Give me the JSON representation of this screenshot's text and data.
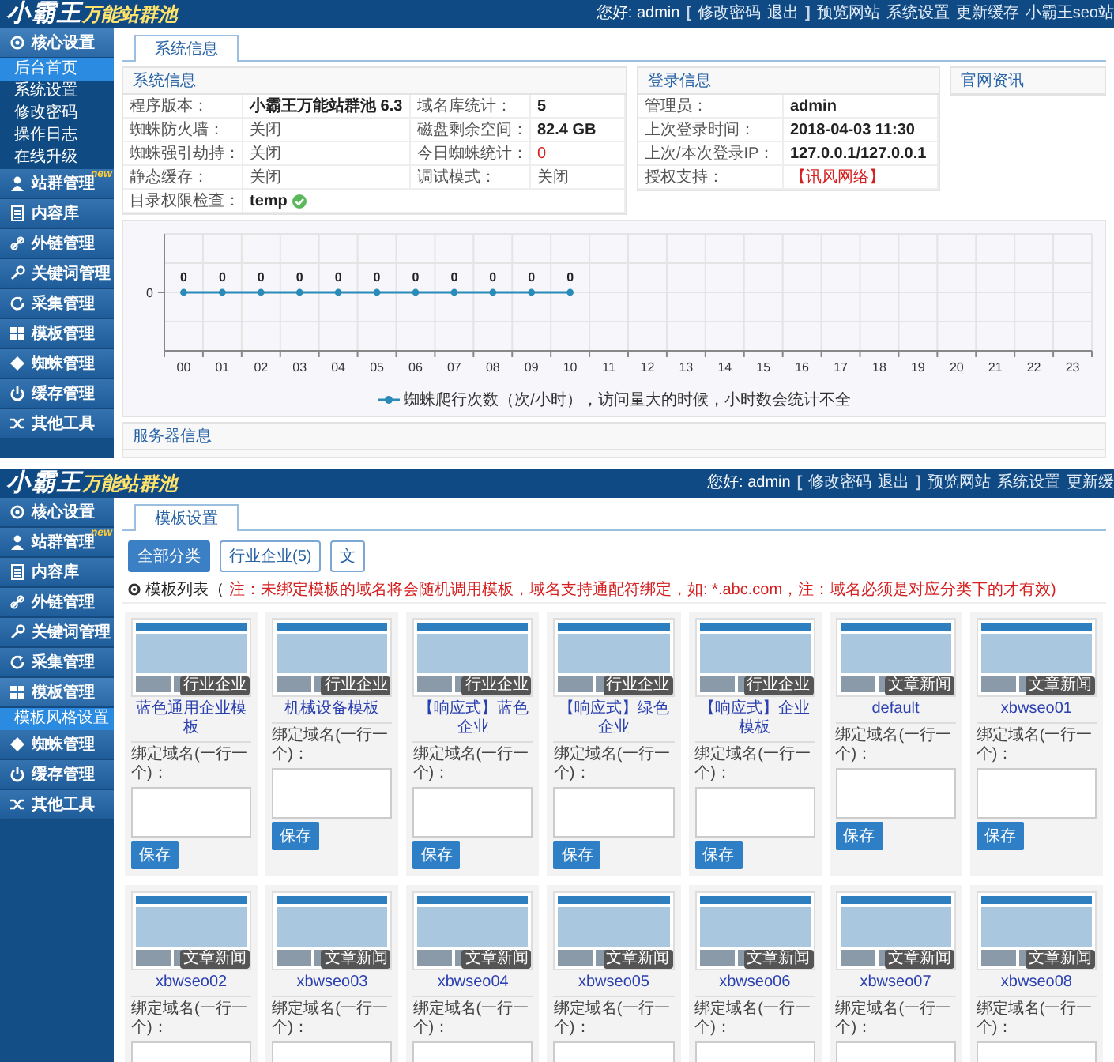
{
  "dashboard_screen": {
    "header": {
      "logo_main": "小霸王",
      "logo_sub": "万能站群池",
      "links": [
        {
          "text": "您好: admin",
          "kind": "greeting"
        },
        {
          "text": "[",
          "kind": "bracket"
        },
        {
          "text": "修改密码",
          "kind": "link"
        },
        {
          "text": "退出",
          "kind": "link"
        },
        {
          "text": "]",
          "kind": "bracket"
        },
        {
          "text": "预览网站",
          "kind": "link"
        },
        {
          "text": "系统设置",
          "kind": "link"
        },
        {
          "text": "更新缓存",
          "kind": "link"
        },
        {
          "text": "小霸王seo站",
          "kind": "link"
        }
      ]
    },
    "sidebar": [
      {
        "label": "核心设置",
        "expanded": true,
        "children": [
          {
            "label": "后台首页",
            "selected": true
          },
          {
            "label": "系统设置",
            "selected": false
          },
          {
            "label": "修改密码",
            "selected": false
          },
          {
            "label": "操作日志",
            "selected": false
          },
          {
            "label": "在线升级",
            "selected": false
          }
        ]
      },
      {
        "label": "站群管理",
        "badge": "new",
        "expanded": false
      },
      {
        "label": "内容库",
        "expanded": false
      },
      {
        "label": "外链管理",
        "expanded": false
      },
      {
        "label": "关键词管理",
        "expanded": false
      },
      {
        "label": "采集管理",
        "expanded": false
      },
      {
        "label": "模板管理",
        "expanded": false
      },
      {
        "label": "蜘蛛管理",
        "expanded": false
      },
      {
        "label": "缓存管理",
        "expanded": false
      },
      {
        "label": "其他工具",
        "expanded": false
      }
    ],
    "tabs": [
      {
        "label": "系统信息",
        "selected": true
      }
    ],
    "system_info": {
      "title": "系统信息",
      "rows": [
        [
          {
            "text": "程序版本：",
            "kind": "label"
          },
          {
            "text": "小霸王万能站群池 6.3",
            "kind": "value"
          },
          {
            "text": "域名库统计：",
            "kind": "label"
          },
          {
            "text": "5",
            "kind": "value"
          }
        ],
        [
          {
            "text": "蜘蛛防火墙：",
            "kind": "label"
          },
          {
            "text": "关闭",
            "kind": "plain"
          },
          {
            "text": "磁盘剩余空间：",
            "kind": "label"
          },
          {
            "text": "82.4 GB",
            "kind": "value"
          }
        ],
        [
          {
            "text": "蜘蛛强引劫持：",
            "kind": "label"
          },
          {
            "text": "关闭",
            "kind": "plain"
          },
          {
            "text": "今日蜘蛛统计：",
            "kind": "label"
          },
          {
            "text": "0",
            "kind": "alert"
          }
        ],
        [
          {
            "text": "静态缓存：",
            "kind": "label"
          },
          {
            "text": "关闭",
            "kind": "plain"
          },
          {
            "text": "调试模式：",
            "kind": "label"
          },
          {
            "text": "关闭",
            "kind": "plain"
          }
        ],
        [
          {
            "text": "目录权限检查：",
            "kind": "label"
          },
          {
            "text": "temp",
            "kind": "value",
            "ok": true
          }
        ]
      ]
    },
    "login_info": {
      "title": "登录信息",
      "rows": [
        [
          {
            "text": "管理员：",
            "kind": "label"
          },
          {
            "text": "admin",
            "kind": "value"
          }
        ],
        [
          {
            "text": "上次登录时间：",
            "kind": "label"
          },
          {
            "text": "2018-04-03 11:30",
            "kind": "value"
          }
        ],
        [
          {
            "text": "上次/本次登录IP：",
            "kind": "label"
          },
          {
            "text": "127.0.0.1/127.0.0.1",
            "kind": "value"
          }
        ],
        [
          {
            "text": "授权支持：",
            "kind": "label"
          },
          {
            "text": "【讯风网络】",
            "kind": "alert"
          }
        ]
      ]
    },
    "news": {
      "title": "官网资讯"
    },
    "chart_panel": {
      "x_labels": [
        "00",
        "01",
        "02",
        "03",
        "04",
        "05",
        "06",
        "07",
        "08",
        "09",
        "10",
        "11",
        "12",
        "13",
        "14",
        "15",
        "16",
        "17",
        "18",
        "19",
        "20",
        "21",
        "22",
        "23"
      ],
      "point_labels": [
        "0",
        "0",
        "0",
        "0",
        "0",
        "0",
        "0",
        "0",
        "0",
        "0",
        "0"
      ],
      "y_axis_label": "0",
      "legend": "蜘蛛爬行次数（次/小时），访问量大的时候，小时数会统计不全"
    },
    "server_info": {
      "title": "服务器信息"
    }
  },
  "template_screen": {
    "header": {
      "logo_main": "小霸王",
      "logo_sub": "万能站群池",
      "links": [
        {
          "text": "您好: admin",
          "kind": "greeting"
        },
        {
          "text": "[",
          "kind": "bracket"
        },
        {
          "text": "修改密码",
          "kind": "link"
        },
        {
          "text": "退出",
          "kind": "link"
        },
        {
          "text": "]",
          "kind": "bracket"
        },
        {
          "text": "预览网站",
          "kind": "link"
        },
        {
          "text": "系统设置",
          "kind": "link"
        },
        {
          "text": "更新缓",
          "kind": "link"
        }
      ]
    },
    "sidebar": [
      {
        "label": "核心设置",
        "expanded": false
      },
      {
        "label": "站群管理",
        "badge": "new",
        "expanded": false
      },
      {
        "label": "内容库",
        "expanded": false
      },
      {
        "label": "外链管理",
        "expanded": false
      },
      {
        "label": "关键词管理",
        "expanded": false
      },
      {
        "label": "采集管理",
        "expanded": false
      },
      {
        "label": "模板管理",
        "expanded": true,
        "children": [
          {
            "label": "模板风格设置",
            "selected": true
          }
        ]
      },
      {
        "label": "蜘蛛管理",
        "expanded": false
      },
      {
        "label": "缓存管理",
        "expanded": false
      },
      {
        "label": "其他工具",
        "expanded": false
      }
    ],
    "tabs": [
      {
        "label": "模板设置",
        "selected": true
      }
    ],
    "filters": [
      {
        "label": "全部分类",
        "selected": true
      },
      {
        "label": "行业企业(5)",
        "selected": false
      },
      {
        "label": "文",
        "selected": false
      }
    ],
    "list_title": "模板列表（",
    "note": "注：未绑定模板的域名将会随机调用模板，域名支持通配符绑定，如: *.abc.com，注：域名必须是对应分类下的才有效)",
    "cards": [
      {
        "name": "蓝色通用企业模板",
        "badge": "行业企业",
        "field_label": "绑定域名(一行一个)：",
        "button": "保存"
      },
      {
        "name": "机械设备模板",
        "badge": "行业企业",
        "field_label": "绑定域名(一行一个)：",
        "button": "保存"
      },
      {
        "name": "【响应式】蓝色企业",
        "badge": "行业企业",
        "field_label": "绑定域名(一行一个)：",
        "button": "保存"
      },
      {
        "name": "【响应式】绿色企业",
        "badge": "行业企业",
        "field_label": "绑定域名(一行一个)：",
        "button": "保存"
      },
      {
        "name": "【响应式】企业模板",
        "badge": "行业企业",
        "field_label": "绑定域名(一行一个)：",
        "button": "保存"
      },
      {
        "name": "default",
        "badge": "文章新闻",
        "field_label": "绑定域名(一行一个)：",
        "button": "保存"
      },
      {
        "name": "xbwseo01",
        "badge": "文章新闻",
        "field_label": "绑定域名(一行一个)：",
        "button": "保存"
      },
      {
        "name": "xbwseo02",
        "badge": "文章新闻",
        "field_label": "绑定域名(一行一个)："
      },
      {
        "name": "xbwseo03",
        "badge": "文章新闻",
        "field_label": "绑定域名(一行一个)："
      },
      {
        "name": "xbwseo04",
        "badge": "文章新闻",
        "field_label": "绑定域名(一行一个)："
      },
      {
        "name": "xbwseo05",
        "badge": "文章新闻",
        "field_label": "绑定域名(一行一个)："
      },
      {
        "name": "xbwseo06",
        "badge": "文章新闻",
        "field_label": "绑定域名(一行一个)："
      },
      {
        "name": "xbwseo07",
        "badge": "文章新闻",
        "field_label": "绑定域名(一行一个)："
      },
      {
        "name": "xbwseo08",
        "badge": "文章新闻",
        "field_label": "绑定域名(一行一个)："
      }
    ]
  }
}
